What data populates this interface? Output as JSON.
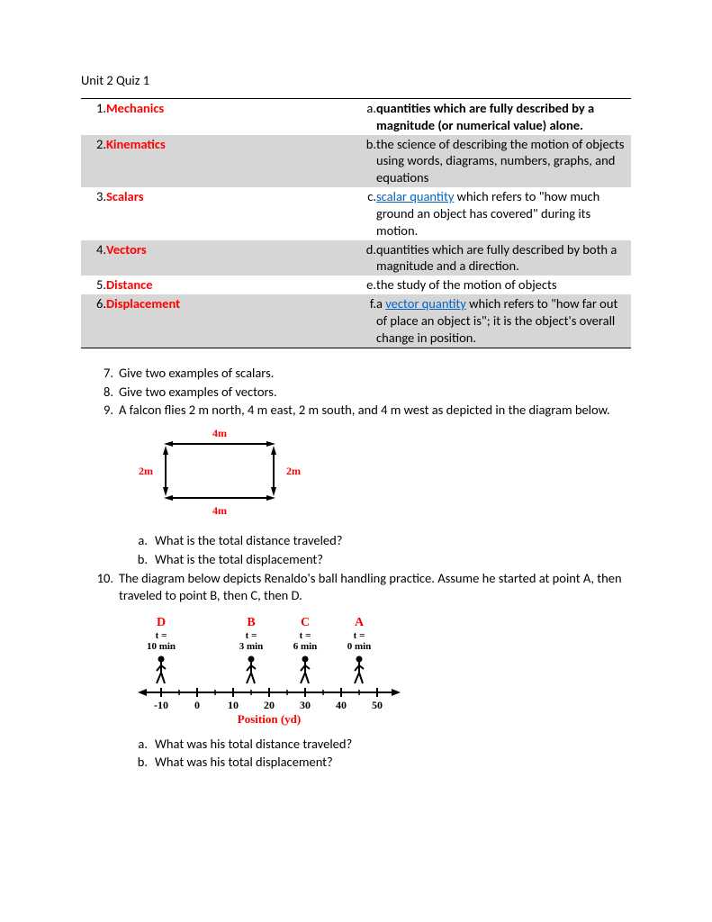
{
  "title": "Unit 2 Quiz 1",
  "match": [
    {
      "ln": "1.",
      "term": "Mechanics",
      "rn": "a.",
      "def_pre": "quantities which are fully described by a magnitude (or numerical value) alone.",
      "bold": true
    },
    {
      "ln": "2.",
      "term": "Kinematics",
      "rn": "b.",
      "def_pre": "the science of describing the motion of objects using words, diagrams, numbers, graphs, and equations"
    },
    {
      "ln": "3.",
      "term": "Scalars",
      "rn": "c.",
      "link": "scalar quantity",
      "def_post": " which refers to \"how much ground an object has covered\" during its motion."
    },
    {
      "ln": "4.",
      "term": "Vectors",
      "rn": "d.",
      "def_pre": "quantities which are fully described by both a magnitude and a direction."
    },
    {
      "ln": "5.",
      "term": "Distance",
      "rn": "e.",
      "def_pre": "the study of the motion of objects"
    },
    {
      "ln": "6.",
      "term": "Displacement",
      "rn": "f.",
      "def_pre": "a ",
      "link": "vector quantity",
      "def_post": " which refers to \"how far out of place an object is\"; it is the object's overall change in position."
    }
  ],
  "q7": {
    "n": "7.",
    "text": "Give two examples of scalars."
  },
  "q8": {
    "n": "8.",
    "text": "Give two examples of vectors."
  },
  "q9": {
    "n": "9.",
    "text": "A falcon flies 2 m north, 4 m east, 2 m south, and 4 m west as depicted in the diagram below."
  },
  "q9a": {
    "l": "a.",
    "text": "What is the total distance traveled?"
  },
  "q9b": {
    "l": "b.",
    "text": "What is the total displacement?"
  },
  "q10": {
    "n": "10.",
    "text": "The diagram below depicts Renaldo's ball handling practice.  Assume he started at point A, then traveled to point B, then C, then D."
  },
  "q10a": {
    "l": "a.",
    "text": "What was his total distance traveled?"
  },
  "q10b": {
    "l": "b.",
    "text": "What was his total displacement?"
  },
  "diag1": {
    "top": "4m",
    "left": "2m",
    "right": "2m",
    "bottom": "4m"
  },
  "diag2": {
    "points": [
      {
        "letter": "D",
        "t1": "t =",
        "t2": "10 min",
        "x": -10
      },
      {
        "letter": "B",
        "t1": "t =",
        "t2": "3 min",
        "x": 15
      },
      {
        "letter": "C",
        "t1": "t =",
        "t2": "6 min",
        "x": 30
      },
      {
        "letter": "A",
        "t1": "t =",
        "t2": "0 min",
        "x": 45
      }
    ],
    "ticks": [
      "-10",
      "0",
      "10",
      "20",
      "30",
      "40",
      "50"
    ],
    "axis": "Position (yd)"
  }
}
